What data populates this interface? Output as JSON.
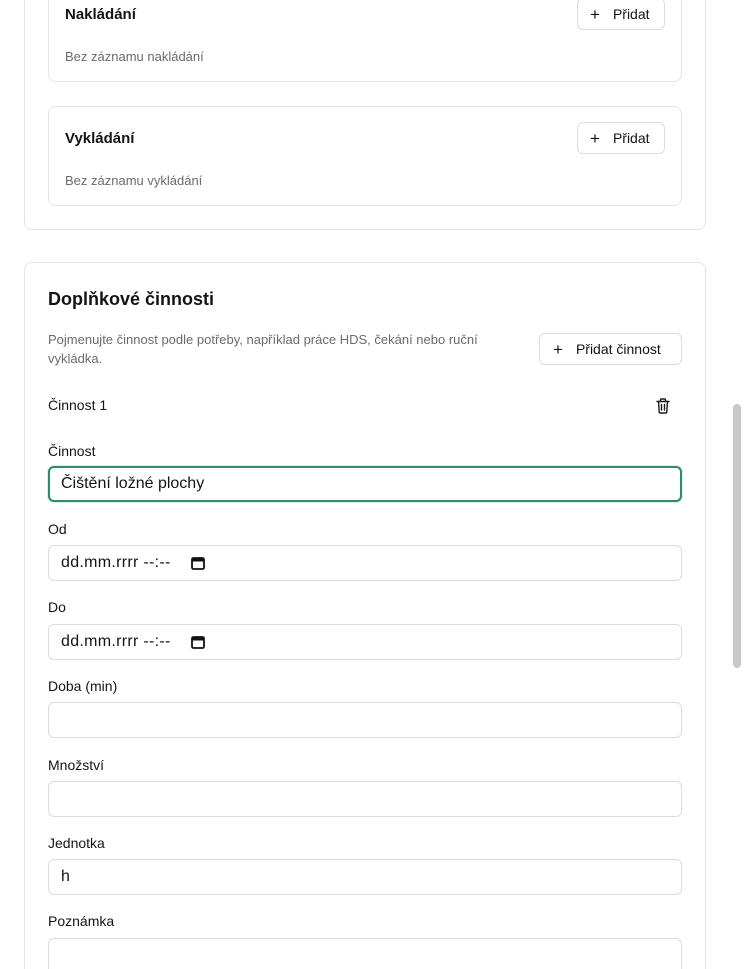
{
  "loading": {
    "title": "Nakládání",
    "empty": "Bez záznamu nakládání",
    "add_label": "Přidat"
  },
  "unloading": {
    "title": "Vykládání",
    "empty": "Bez záznamu vykládání",
    "add_label": "Přidat"
  },
  "extra": {
    "title": "Doplňkové činnosti",
    "description": "Pojmenujte činnost podle potřeby, například práce HDS, čekání nebo ruční vykládka.",
    "add_label": "Přidat činnost",
    "activity_label": "Činnost 1",
    "fields": {
      "activity": {
        "label": "Činnost",
        "value": "Čištění ložné plochy"
      },
      "from": {
        "label": "Od",
        "value": "dd.mm.rrrr --:--"
      },
      "to": {
        "label": "Do",
        "value": "dd.mm.rrrr --:--"
      },
      "duration": {
        "label": "Doba (min)",
        "value": ""
      },
      "quantity": {
        "label": "Množství",
        "value": ""
      },
      "unit": {
        "label": "Jednotka",
        "value": "h"
      },
      "note": {
        "label": "Poznámka",
        "value": ""
      }
    }
  },
  "icons": {
    "add": "plus-icon",
    "delete": "trash-icon",
    "calendar": "calendar-icon"
  },
  "colors": {
    "focus_border": "#2e8b6e",
    "muted_text": "#6b6b6b",
    "border": "#e5e5e5"
  }
}
